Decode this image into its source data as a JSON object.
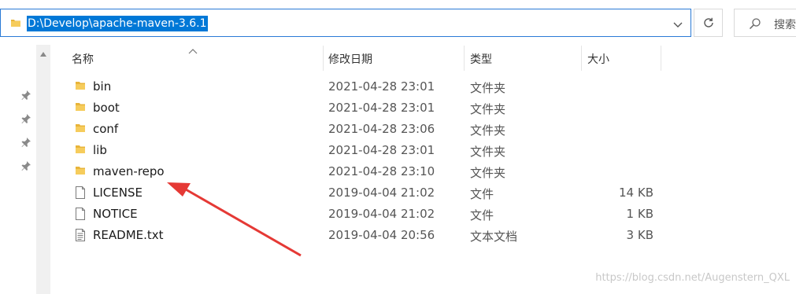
{
  "address": {
    "path": "D:\\Develop\\apache-maven-3.6.1"
  },
  "search": {
    "placeholder": "搜索"
  },
  "columns": {
    "name": "名称",
    "date": "修改日期",
    "type": "类型",
    "size": "大小"
  },
  "files": [
    {
      "name": "bin",
      "date": "2021-04-28 23:01",
      "type": "文件夹",
      "size": "",
      "icon": "folder-icon"
    },
    {
      "name": "boot",
      "date": "2021-04-28 23:01",
      "type": "文件夹",
      "size": "",
      "icon": "folder-icon"
    },
    {
      "name": "conf",
      "date": "2021-04-28 23:06",
      "type": "文件夹",
      "size": "",
      "icon": "folder-icon"
    },
    {
      "name": "lib",
      "date": "2021-04-28 23:01",
      "type": "文件夹",
      "size": "",
      "icon": "folder-icon"
    },
    {
      "name": "maven-repo",
      "date": "2021-04-28 23:10",
      "type": "文件夹",
      "size": "",
      "icon": "folder-icon"
    },
    {
      "name": "LICENSE",
      "date": "2019-04-04 21:02",
      "type": "文件",
      "size": "14 KB",
      "icon": "file-icon"
    },
    {
      "name": "NOTICE",
      "date": "2019-04-04 21:02",
      "type": "文件",
      "size": "1 KB",
      "icon": "file-icon"
    },
    {
      "name": "README.txt",
      "date": "2019-04-04 20:56",
      "type": "文本文档",
      "size": "3 KB",
      "icon": "text-file-icon"
    }
  ],
  "watermark": "https://blog.csdn.net/Augenstern_QXL",
  "colors": {
    "selection": "#0078d7",
    "folder": "#f2c14e",
    "arrow": "#e53935",
    "focus_border": "#2a7ad6"
  }
}
